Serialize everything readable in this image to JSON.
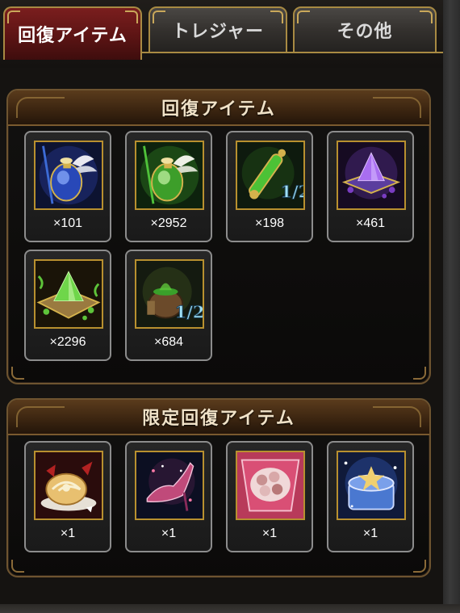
{
  "tabs": [
    {
      "label": "回復アイテム",
      "active": true
    },
    {
      "label": "トレジャー",
      "active": false
    },
    {
      "label": "その他",
      "active": false
    }
  ],
  "sections": [
    {
      "title": "回復アイテム",
      "items": [
        {
          "icon": "blue-winged-potion-icon",
          "count": "×101"
        },
        {
          "icon": "green-winged-potion-icon",
          "count": "×2952"
        },
        {
          "icon": "green-vial-half-icon",
          "count": "×198"
        },
        {
          "icon": "purple-crystal-cushion-icon",
          "count": "×461"
        },
        {
          "icon": "green-crystal-cushion-icon",
          "count": "×2296"
        },
        {
          "icon": "pot-half-icon",
          "count": "×684"
        }
      ]
    },
    {
      "title": "限定回復アイテム",
      "items": [
        {
          "icon": "cake-roll-icon",
          "count": "×1"
        },
        {
          "icon": "crystal-shoe-icon",
          "count": "×1"
        },
        {
          "icon": "chocolate-box-icon",
          "count": "×1"
        },
        {
          "icon": "blue-gift-box-icon",
          "count": "×1"
        }
      ]
    }
  ],
  "colors": {
    "active_tab": "#7a1e1e",
    "gold_border": "#b8902f",
    "panel_header": "#5a3b1c"
  }
}
